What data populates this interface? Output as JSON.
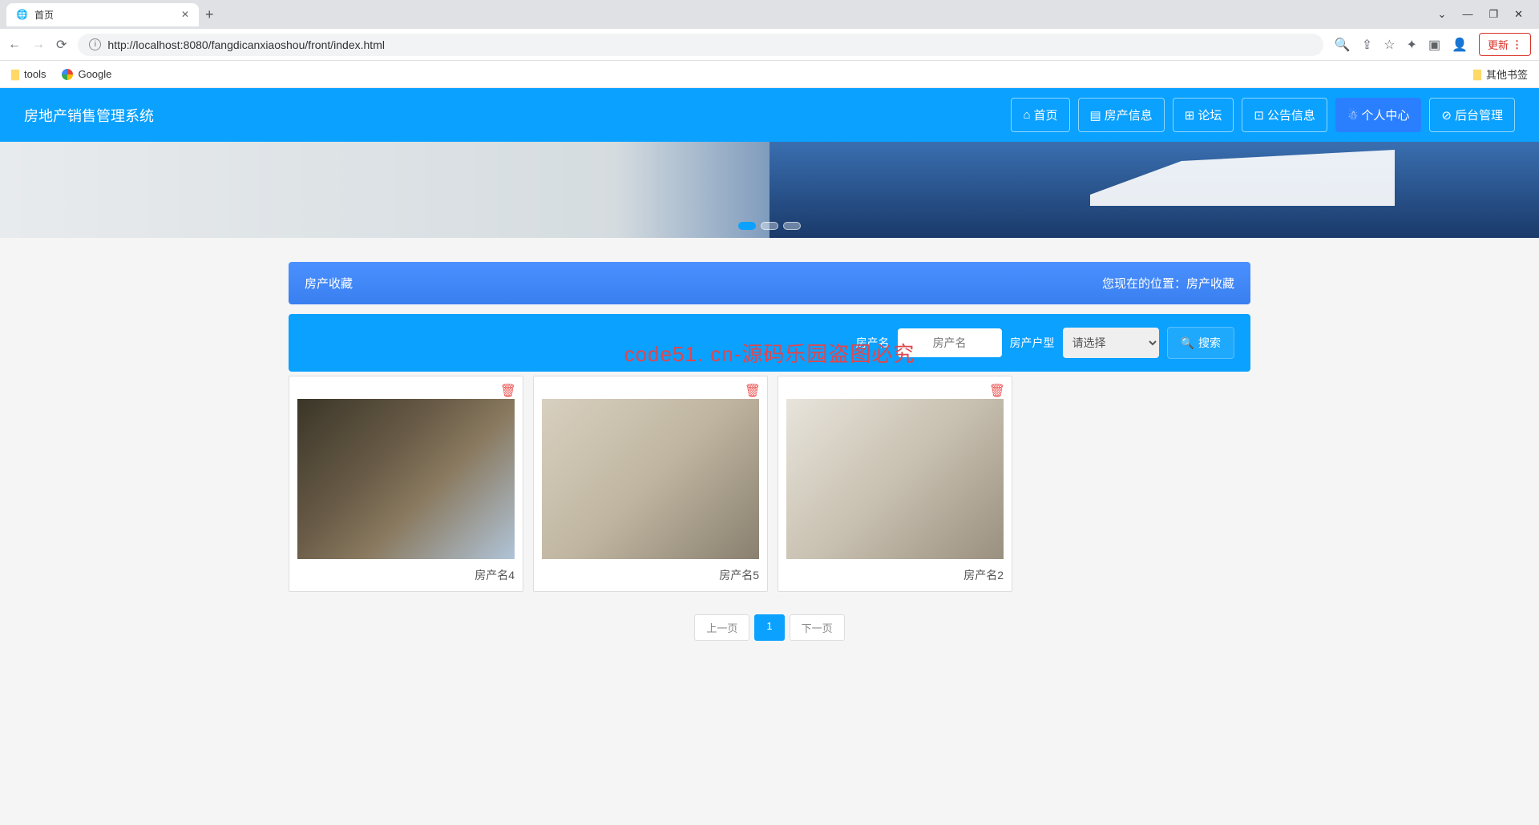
{
  "browser": {
    "tab_title": "首页",
    "url": "http://localhost:8080/fangdicanxiaoshou/front/index.html",
    "update_label": "更新",
    "bookmarks": {
      "tools": "tools",
      "google": "Google",
      "other": "其他书签"
    }
  },
  "nav": {
    "brand": "房地产销售管理系统",
    "links": {
      "home": "首页",
      "info": "房产信息",
      "forum": "论坛",
      "notice": "公告信息",
      "center": "个人中心",
      "admin": "后台管理"
    }
  },
  "crumb": {
    "title": "房产收藏",
    "loc_label": "您现在的位置：",
    "loc_value": "房产收藏"
  },
  "search": {
    "name_label": "房产名",
    "name_placeholder": "房产名",
    "type_label": "房产户型",
    "type_option": "请选择",
    "button": "搜索"
  },
  "watermark_red": "code51. cn-源码乐园盗图必究",
  "cards": [
    {
      "name": "房产名4"
    },
    {
      "name": "房产名5"
    },
    {
      "name": "房产名2"
    }
  ],
  "pager": {
    "prev": "上一页",
    "page": "1",
    "next": "下一页"
  },
  "wm_text": "code51.cn"
}
